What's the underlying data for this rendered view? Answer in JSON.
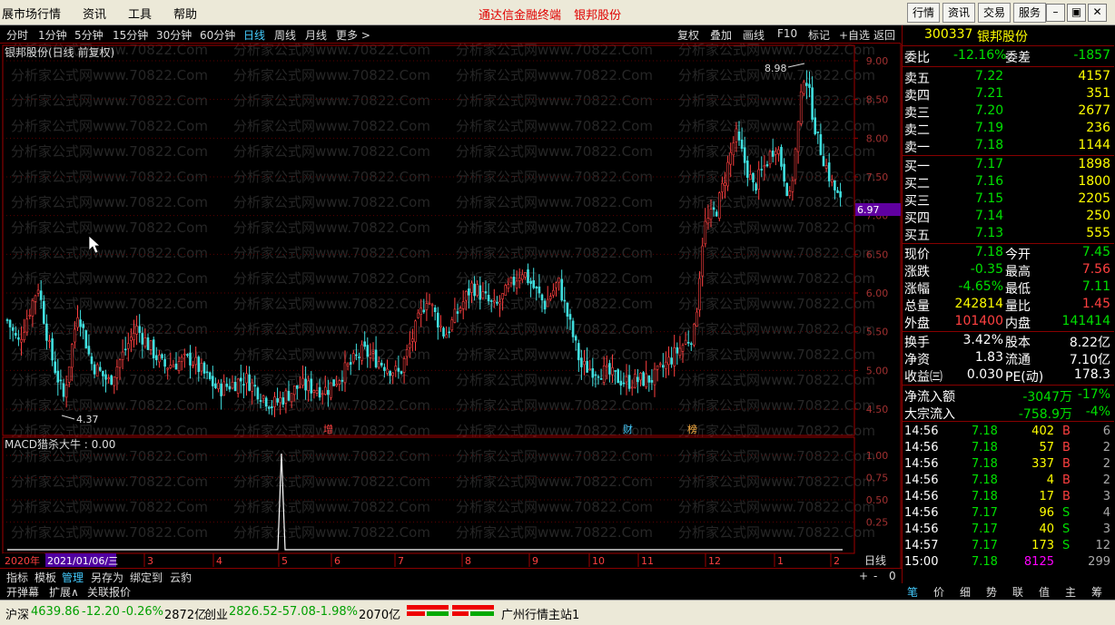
{
  "menu": [
    "展市场行情",
    "资讯",
    "工具",
    "帮助"
  ],
  "app_title": "通达信金融终端",
  "stock_title": "银邦股份",
  "title_buttons": [
    "行情",
    "资讯",
    "交易",
    "服务"
  ],
  "periods": [
    "分时",
    "1分钟",
    "5分钟",
    "15分钟",
    "30分钟",
    "60分钟",
    "日线",
    "周线",
    "月线",
    "更多 >"
  ],
  "active_period": "日线",
  "chart_tools": [
    "复权",
    "叠加",
    "画线",
    "F10",
    "标记",
    "+自选",
    "返回"
  ],
  "chart_caption": "银邦股份(日线 前复权)",
  "watermark": "分析家公式网www.70822.Com",
  "price_axis": [
    "9.00",
    "8.50",
    "8.00",
    "7.50",
    "7.00",
    "6.50",
    "6.00",
    "5.50",
    "5.00",
    "4.50"
  ],
  "current_price_tag": "6.97",
  "high_label": "8.98",
  "low_label": "4.37",
  "event_markers": [
    "增",
    "财",
    "榜"
  ],
  "macd_label": "MACD猎杀大牛 : 0.00",
  "macd_axis": [
    "1.00",
    "0.75",
    "0.50",
    "0.25"
  ],
  "date_axis": {
    "year": "2020年",
    "cursor_date": "2021/01/06/三",
    "months": [
      "3",
      "4",
      "5",
      "6",
      "7",
      "8",
      "9",
      "10",
      "11",
      "12",
      "1",
      "2"
    ],
    "scale": "日线"
  },
  "zoom_controls": [
    "+",
    "-",
    "0"
  ],
  "bottom_tabs": [
    "指标",
    "模板",
    "管理",
    "另存为",
    "绑定到",
    "云豹"
  ],
  "active_bottom_tab": "管理",
  "bottom_row2": [
    "开弹幕",
    "扩展∧",
    "关联报价"
  ],
  "quote": {
    "code": "300337",
    "name": "银邦股份",
    "weibi_label": "委比",
    "weibi": "-12.16%",
    "weicha_label": "委差",
    "weicha": "-1857",
    "sell": [
      {
        "label": "卖五",
        "price": "7.22",
        "vol": "4157"
      },
      {
        "label": "卖四",
        "price": "7.21",
        "vol": "351"
      },
      {
        "label": "卖三",
        "price": "7.20",
        "vol": "2677"
      },
      {
        "label": "卖二",
        "price": "7.19",
        "vol": "236"
      },
      {
        "label": "卖一",
        "price": "7.18",
        "vol": "1144"
      }
    ],
    "buy": [
      {
        "label": "买一",
        "price": "7.17",
        "vol": "1898"
      },
      {
        "label": "买二",
        "price": "7.16",
        "vol": "1800"
      },
      {
        "label": "买三",
        "price": "7.15",
        "vol": "2205"
      },
      {
        "label": "买四",
        "price": "7.14",
        "vol": "250"
      },
      {
        "label": "买五",
        "price": "7.13",
        "vol": "555"
      }
    ],
    "stats": [
      {
        "l1": "现价",
        "v1": "7.18",
        "c1": "dn",
        "l2": "今开",
        "v2": "7.45",
        "c2": "dn"
      },
      {
        "l1": "涨跌",
        "v1": "-0.35",
        "c1": "dn",
        "l2": "最高",
        "v2": "7.56",
        "c2": "up"
      },
      {
        "l1": "涨幅",
        "v1": "-4.65%",
        "c1": "dn",
        "l2": "最低",
        "v2": "7.11",
        "c2": "dn"
      },
      {
        "l1": "总量",
        "v1": "242814",
        "c1": "yl",
        "l2": "量比",
        "v2": "1.45",
        "c2": "up"
      },
      {
        "l1": "外盘",
        "v1": "101400",
        "c1": "up",
        "l2": "内盘",
        "v2": "141414",
        "c2": "dn"
      }
    ],
    "fund": [
      {
        "l1": "换手",
        "v1": "3.42%",
        "l2": "股本",
        "v2": "8.22亿"
      },
      {
        "l1": "净资",
        "v1": "1.83",
        "l2": "流通",
        "v2": "7.10亿"
      },
      {
        "l1": "收益㈢",
        "v1": "0.030",
        "l2": "PE(动)",
        "v2": "178.3"
      }
    ],
    "flows": [
      {
        "label": "净流入额",
        "value": "-3047万",
        "pct": "-17%"
      },
      {
        "label": "大宗流入",
        "value": "-758.9万",
        "pct": "-4%"
      }
    ],
    "ticks": [
      {
        "time": "14:56",
        "price": "7.18",
        "vol": "402",
        "bs": "B",
        "n": "6"
      },
      {
        "time": "14:56",
        "price": "7.18",
        "vol": "57",
        "bs": "B",
        "n": "2"
      },
      {
        "time": "14:56",
        "price": "7.18",
        "vol": "337",
        "bs": "B",
        "n": "2"
      },
      {
        "time": "14:56",
        "price": "7.18",
        "vol": "4",
        "bs": "B",
        "n": "2"
      },
      {
        "time": "14:56",
        "price": "7.18",
        "vol": "17",
        "bs": "B",
        "n": "3"
      },
      {
        "time": "14:56",
        "price": "7.17",
        "vol": "96",
        "bs": "S",
        "n": "4"
      },
      {
        "time": "14:56",
        "price": "7.17",
        "vol": "40",
        "bs": "S",
        "n": "3"
      },
      {
        "time": "14:57",
        "price": "7.17",
        "vol": "173",
        "bs": "S",
        "n": "12"
      },
      {
        "time": "15:00",
        "price": "7.18",
        "vol": "8125",
        "bs": "",
        "n": "299"
      }
    ],
    "tabs": [
      "笔",
      "价",
      "细",
      "势",
      "联",
      "值",
      "主",
      "筹"
    ]
  },
  "status": {
    "sh_label": "沪深",
    "sh_val": "4639.86",
    "sh_chg": "-12.20",
    "sh_pct": "-0.26%",
    "sh_amt": "2872亿",
    "cy_label": "创业",
    "cy_val": "2826.52",
    "cy_chg": "-57.08",
    "cy_pct": "-1.98%",
    "cy_amt": "2070亿",
    "server": "广州行情主站1"
  }
}
